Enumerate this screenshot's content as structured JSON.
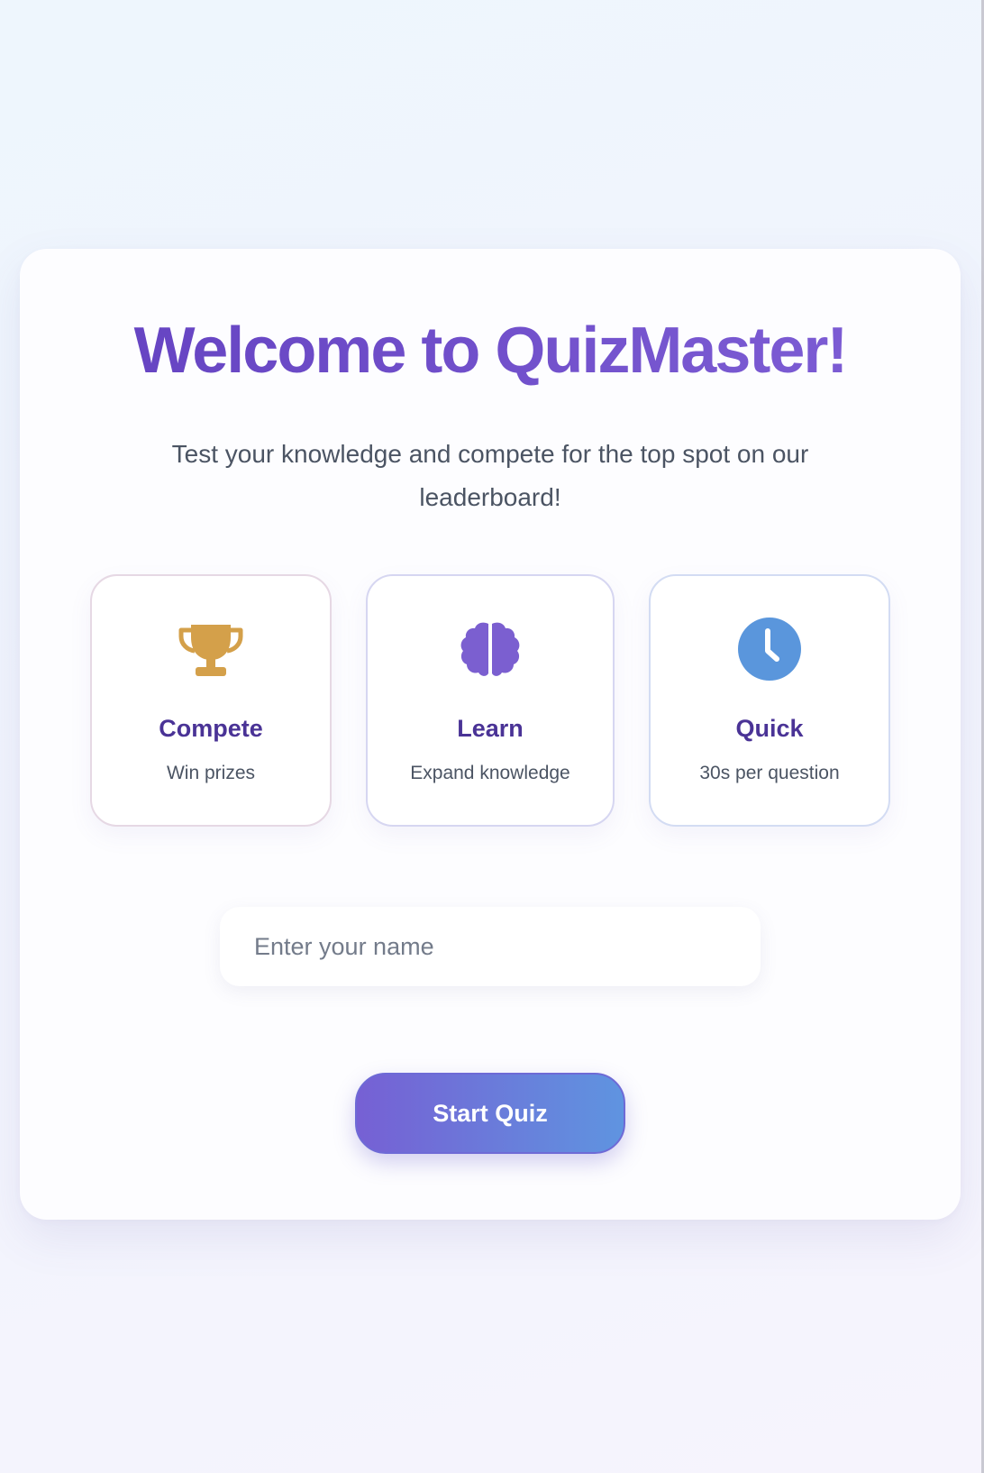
{
  "welcome": {
    "title": "Welcome to QuizMaster!",
    "subtitle": "Test your knowledge and compete for the top spot on our leaderboard!"
  },
  "features": [
    {
      "icon": "trophy-icon",
      "title": "Compete",
      "description": "Win prizes",
      "color": "#d4a04a"
    },
    {
      "icon": "brain-icon",
      "title": "Learn",
      "description": "Expand knowledge",
      "color": "#7b5fd0"
    },
    {
      "icon": "clock-icon",
      "title": "Quick",
      "description": "30s per question",
      "color": "#5a96dc"
    }
  ],
  "name_input": {
    "placeholder": "Enter your name",
    "value": ""
  },
  "start_button": {
    "label": "Start Quiz"
  },
  "colors": {
    "title_gradient_start": "#6341c0",
    "title_gradient_end": "#7f5fd6",
    "feature_title": "#4a3396",
    "body_text": "#4b5463",
    "button_gradient_start": "#7660d4",
    "button_gradient_end": "#5f94e0"
  }
}
